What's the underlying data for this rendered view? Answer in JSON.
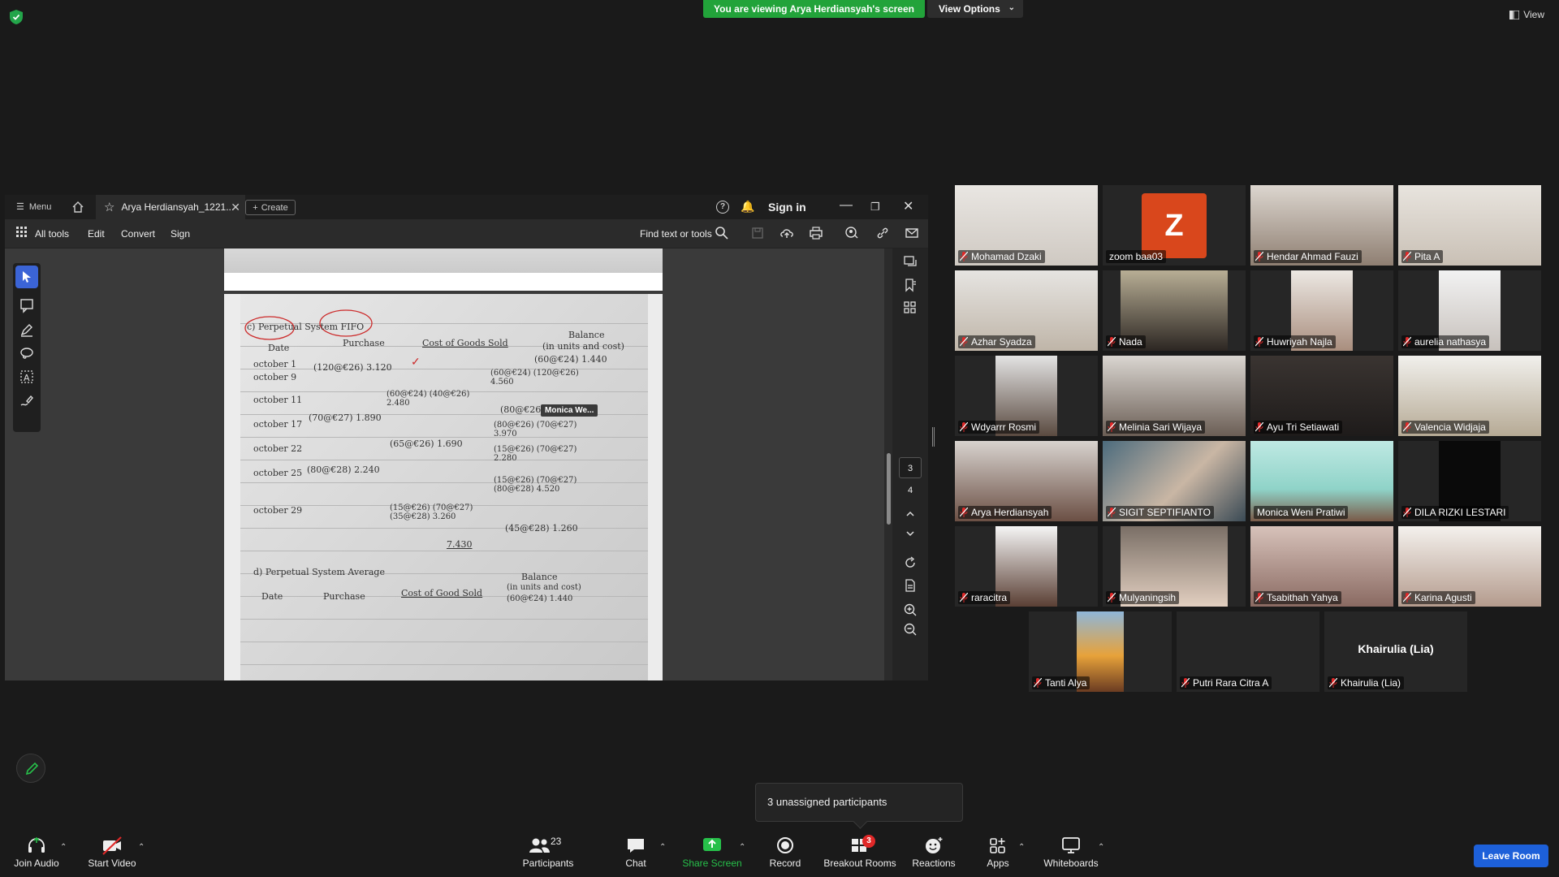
{
  "banner": {
    "viewing": "You are viewing Arya Herdiansyah's screen",
    "view_options": "View Options",
    "view": "View"
  },
  "acrobat": {
    "menu": "Menu",
    "tab_title": "Arya Herdiansyah_1221...",
    "create": "Create",
    "help": "?",
    "sign_in": "Sign in",
    "toolbar": {
      "all_tools": "All tools",
      "edit": "Edit",
      "convert": "Convert",
      "sign": "Sign",
      "find": "Find text or tools"
    },
    "page_current": "3",
    "page_next": "4",
    "cursor_label": "Monica We..."
  },
  "document": {
    "heading_1": "c) Perpetual System FIFO",
    "col_date": "Date",
    "col_purchase": "Purchase",
    "col_cogs": "Cost of Goods Sold",
    "col_balance": "Balance",
    "col_balance_sub": "(in units and cost)",
    "rows": [
      {
        "date": "october 1",
        "purchase": "",
        "cogs": "",
        "balance": "(60@€24) 1.440"
      },
      {
        "date": "october 9",
        "purchase": "(120@€26) 3.120",
        "cogs": "",
        "balance": "(60@€24) (120@€26) 4.560"
      },
      {
        "date": "october 11",
        "purchase": "",
        "cogs": "(60@€24) (40@€26) 2.480",
        "balance": "(80@€26) 2.080"
      },
      {
        "date": "october 17",
        "purchase": "(70@€27) 1.890",
        "cogs": "",
        "balance": "(80@€26) (70@€27) 3.970"
      },
      {
        "date": "october 22",
        "purchase": "",
        "cogs": "(65@€26) 1.690",
        "balance": "(15@€26) (70@€27) 2.280"
      },
      {
        "date": "october 25",
        "purchase": "(80@€28) 2.240",
        "cogs": "",
        "balance": "(15@€26) (70@€27) (80@€28) 4.520"
      },
      {
        "date": "october 29",
        "purchase": "",
        "cogs": "(15@€26) (70@€27) (35@€28) 3.260",
        "balance": "(45@€28) 1.260"
      }
    ],
    "total_cogs": "7.430",
    "heading_2": "d) Perpetual System Average",
    "col2_date": "Date",
    "col2_purchase": "Purchase",
    "col2_cogs": "Cost of Good Sold",
    "col2_balance": "Balance",
    "col2_balance_sub": "(in units and cost)",
    "col2_first": "(60@€24) 1.440"
  },
  "participants": [
    {
      "name": "Mohamad Dzaki",
      "muted": true
    },
    {
      "name": "zoom baa03",
      "muted": false,
      "avatar_letter": "Z"
    },
    {
      "name": "Hendar Ahmad Fauzi",
      "muted": true
    },
    {
      "name": "Pita A",
      "muted": true
    },
    {
      "name": "Azhar Syadza",
      "muted": true
    },
    {
      "name": "Nada",
      "muted": true
    },
    {
      "name": "Huwriyah Najla",
      "muted": true
    },
    {
      "name": "aurelia nathasya",
      "muted": true
    },
    {
      "name": "Wdyarrr Rosmi",
      "muted": true
    },
    {
      "name": "Melinia Sari Wijaya",
      "muted": true
    },
    {
      "name": "Ayu Tri Setiawati",
      "muted": true
    },
    {
      "name": "Valencia Widjaja",
      "muted": true
    },
    {
      "name": "Arya Herdiansyah",
      "muted": true
    },
    {
      "name": "SIGIT SEPTIFIANTO",
      "muted": true
    },
    {
      "name": "Monica Weni Pratiwi",
      "muted": false,
      "active": true
    },
    {
      "name": "DILA RIZKI LESTARI",
      "muted": true
    },
    {
      "name": "raracitra",
      "muted": true
    },
    {
      "name": "Mulyaningsih",
      "muted": true
    },
    {
      "name": "Tsabithah Yahya",
      "muted": true
    },
    {
      "name": "Karina Agusti",
      "muted": true
    },
    {
      "name": "Tanti Alya",
      "muted": true
    },
    {
      "name": "Putri Rara Citra A",
      "muted": true
    },
    {
      "name": "Khairulia (Lia)",
      "muted": true,
      "big_label": "Khairulia (Lia)"
    }
  ],
  "popup": {
    "text": "3 unassigned participants"
  },
  "toolbar": {
    "join_audio": "Join Audio",
    "start_video": "Start Video",
    "participants": "Participants",
    "participants_count": "23",
    "chat": "Chat",
    "share_screen": "Share Screen",
    "record": "Record",
    "breakout_rooms": "Breakout Rooms",
    "breakout_badge": "3",
    "reactions": "Reactions",
    "apps": "Apps",
    "whiteboards": "Whiteboards",
    "leave": "Leave Room"
  },
  "colors": {
    "banner_green": "#22a33a",
    "share_green": "#27c04a",
    "leave_blue": "#1d60d9",
    "muted_red": "#e02828",
    "active_outline": "#c6ff6b",
    "avatar_orange": "#d9471c"
  }
}
